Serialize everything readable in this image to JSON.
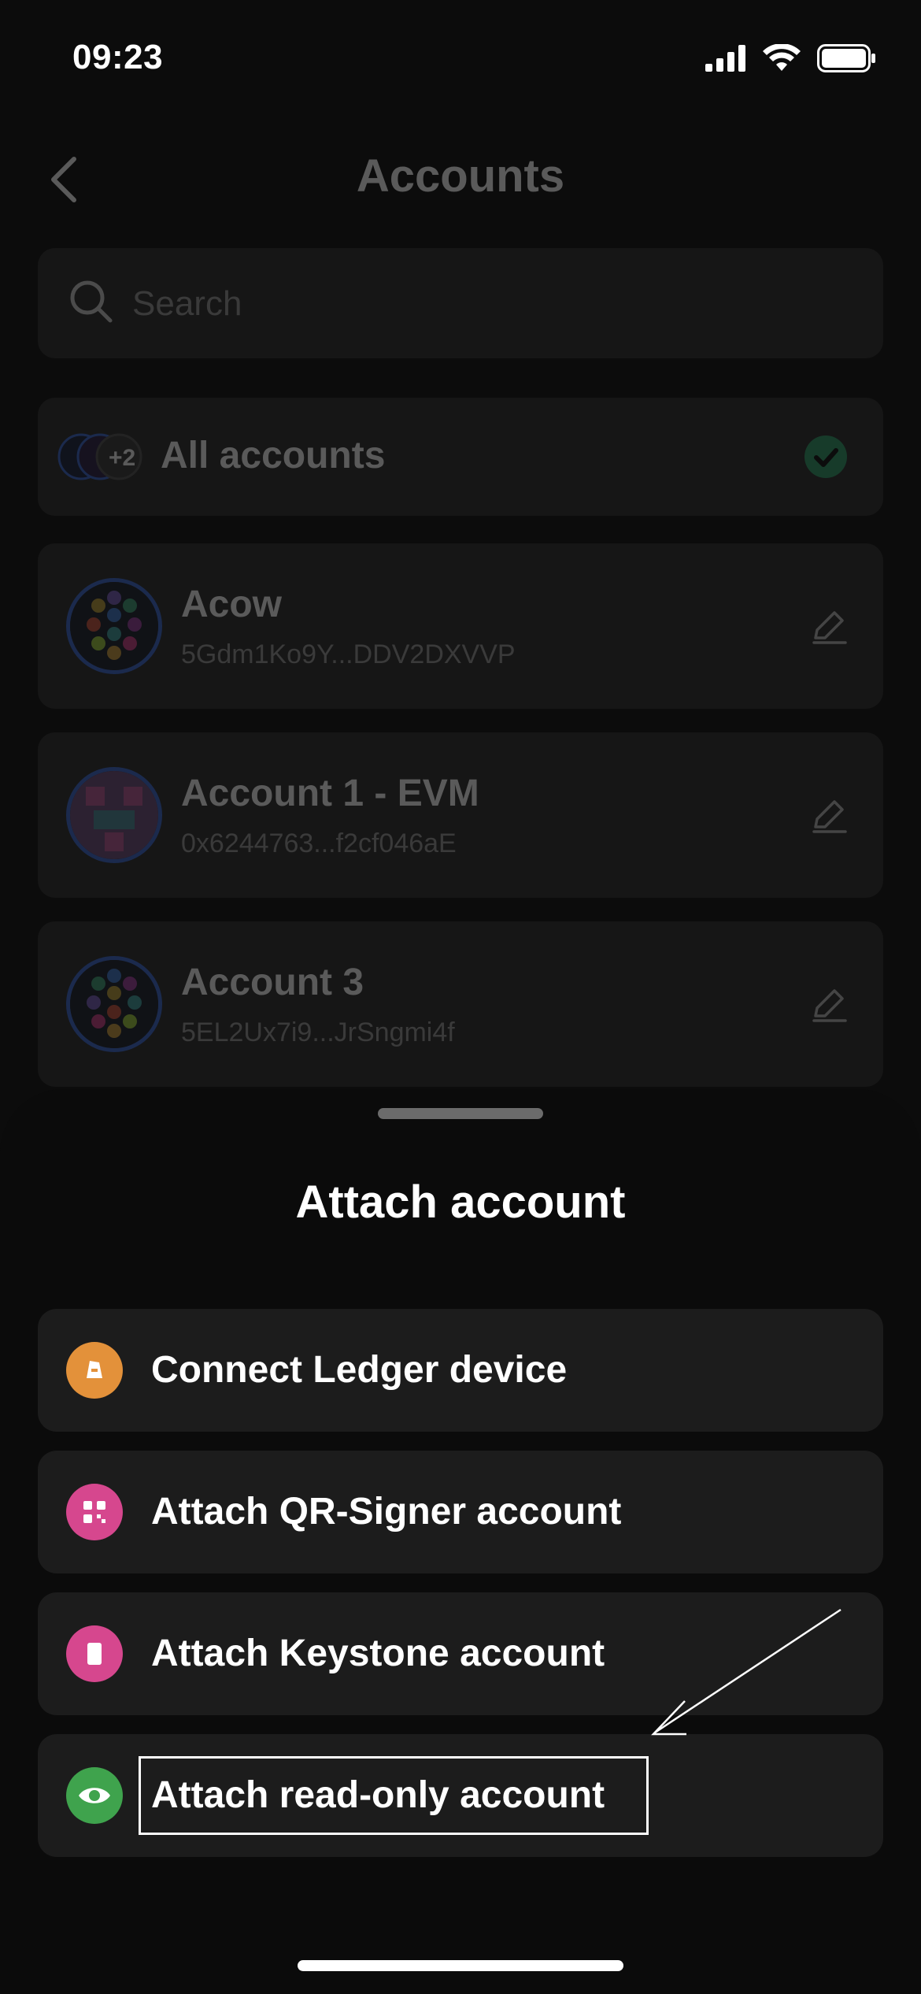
{
  "status_bar": {
    "time": "09:23"
  },
  "header": {
    "title": "Accounts"
  },
  "search": {
    "placeholder": "Search"
  },
  "all_accounts": {
    "label": "All accounts",
    "badge": "+2"
  },
  "accounts": [
    {
      "name": "Acow",
      "address": "5Gdm1Ko9Y...DDV2DXVVP"
    },
    {
      "name": "Account 1 - EVM",
      "address": "0x6244763...f2cf046aE"
    },
    {
      "name": "Account 3",
      "address": "5EL2Ux7i9...JrSngmi4f"
    }
  ],
  "sheet": {
    "title": "Attach account",
    "options": [
      {
        "label": "Connect Ledger device",
        "icon": "ledger-icon",
        "color": "#e3913a"
      },
      {
        "label": "Attach QR-Signer account",
        "icon": "qr-icon",
        "color": "#d6478e"
      },
      {
        "label": "Attach Keystone account",
        "icon": "keystone-icon",
        "color": "#d6478e"
      },
      {
        "label": "Attach read-only account",
        "icon": "eye-icon",
        "color": "#3fa34d"
      }
    ]
  },
  "colors": {
    "accent_green": "#2f9e6b",
    "avatar_ring": "#3d6bd6"
  }
}
